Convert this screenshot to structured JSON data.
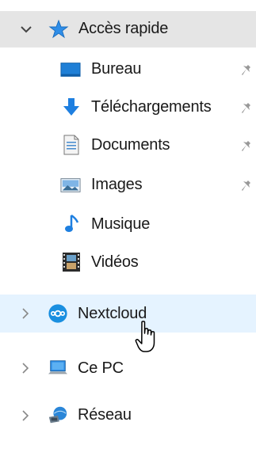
{
  "nav": {
    "quick_access": {
      "label": "Accès rapide",
      "expanded": true,
      "items": [
        {
          "label": "Bureau",
          "icon": "desktop-icon",
          "pinned": true
        },
        {
          "label": "Téléchargements",
          "icon": "download-arrow-icon",
          "pinned": true
        },
        {
          "label": "Documents",
          "icon": "document-icon",
          "pinned": true
        },
        {
          "label": "Images",
          "icon": "pictures-icon",
          "pinned": true
        },
        {
          "label": "Musique",
          "icon": "music-note-icon",
          "pinned": false
        },
        {
          "label": "Vidéos",
          "icon": "film-strip-icon",
          "pinned": false
        }
      ]
    },
    "nextcloud": {
      "label": "Nextcloud",
      "icon": "nextcloud-icon",
      "hovered": true
    },
    "this_pc": {
      "label": "Ce PC",
      "icon": "computer-icon"
    },
    "network": {
      "label": "Réseau",
      "icon": "network-icon"
    }
  },
  "colors": {
    "selected_bg": "#e5e5e5",
    "hover_bg": "#e5f3ff",
    "accent_blue": "#1e90ff"
  }
}
